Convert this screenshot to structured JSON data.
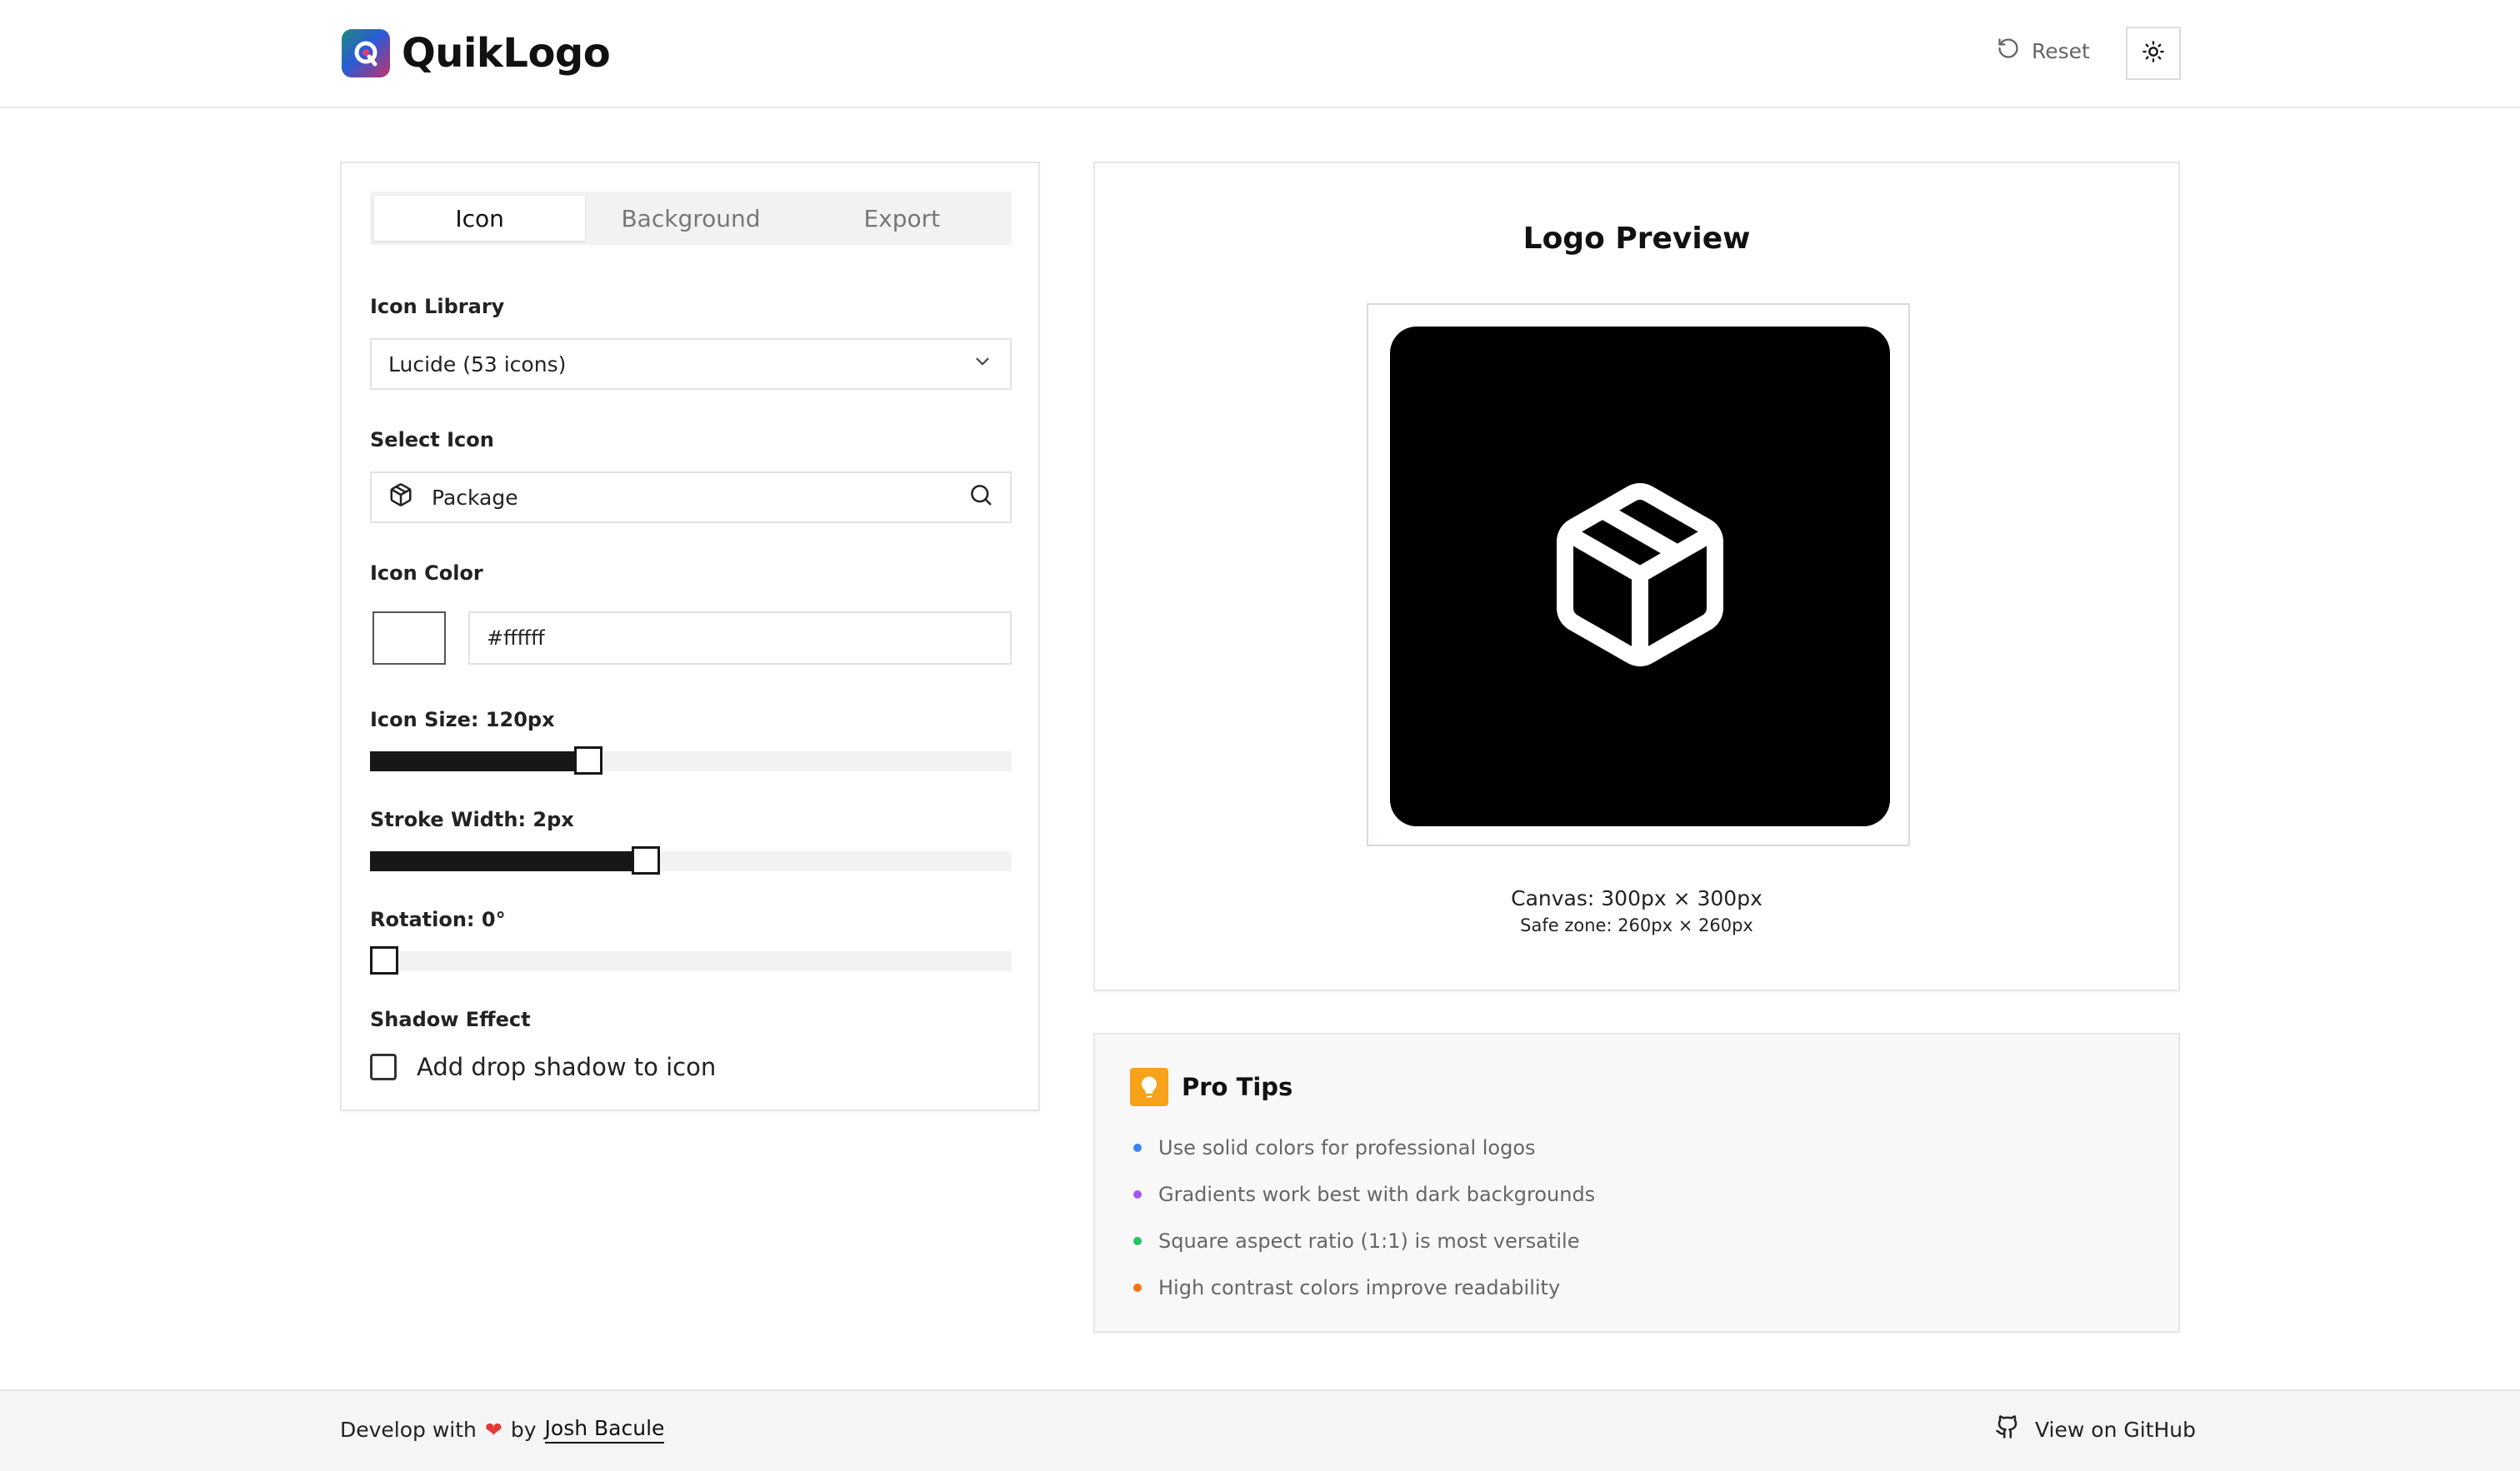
{
  "app": {
    "name": "QuikLogo",
    "logo_icon": "quiklogo-brand-icon",
    "reset_label": "Reset",
    "reset_icon": "rotate-ccw-icon",
    "theme_icon": "sun-icon"
  },
  "tabs": [
    {
      "label": "Icon",
      "active": true
    },
    {
      "label": "Background",
      "active": false
    },
    {
      "label": "Export",
      "active": false
    }
  ],
  "icon_library": {
    "label": "Icon Library",
    "selected": "Lucide (53 icons)"
  },
  "select_icon": {
    "label": "Select Icon",
    "value": "Package",
    "icon": "package-icon"
  },
  "icon_color": {
    "label": "Icon Color",
    "value": "#ffffff"
  },
  "icon_size": {
    "label": "Icon Size: 120px",
    "fraction": 0.34
  },
  "stroke_width": {
    "label": "Stroke Width: 2px",
    "fraction": 0.43
  },
  "rotation": {
    "label": "Rotation: 0°",
    "fraction": 0.0
  },
  "shadow": {
    "label": "Shadow Effect",
    "checkbox_label": "Add drop shadow to icon",
    "checked": false
  },
  "preview": {
    "title": "Logo Preview",
    "canvas_label": "Canvas: 300px × 300px",
    "safe_zone_label": "Safe zone: 260px × 260px",
    "background_color": "#000000",
    "icon_color": "#ffffff"
  },
  "tips": {
    "title": "Pro Tips",
    "icon": "lightbulb-icon",
    "accent": "#f6a21a",
    "items": [
      {
        "text": "Use solid colors for professional logos",
        "dot_color": "#3b82f6"
      },
      {
        "text": "Gradients work best with dark backgrounds",
        "dot_color": "#a855f7"
      },
      {
        "text": "Square aspect ratio (1:1) is most versatile",
        "dot_color": "#22c55e"
      },
      {
        "text": "High contrast colors improve readability",
        "dot_color": "#f97316"
      }
    ]
  },
  "footer": {
    "prefix": "Develop with",
    "heart": "❤",
    "by": "by",
    "author": "Josh Bacule",
    "github_label": "View on GitHub",
    "github_icon": "github-icon"
  }
}
